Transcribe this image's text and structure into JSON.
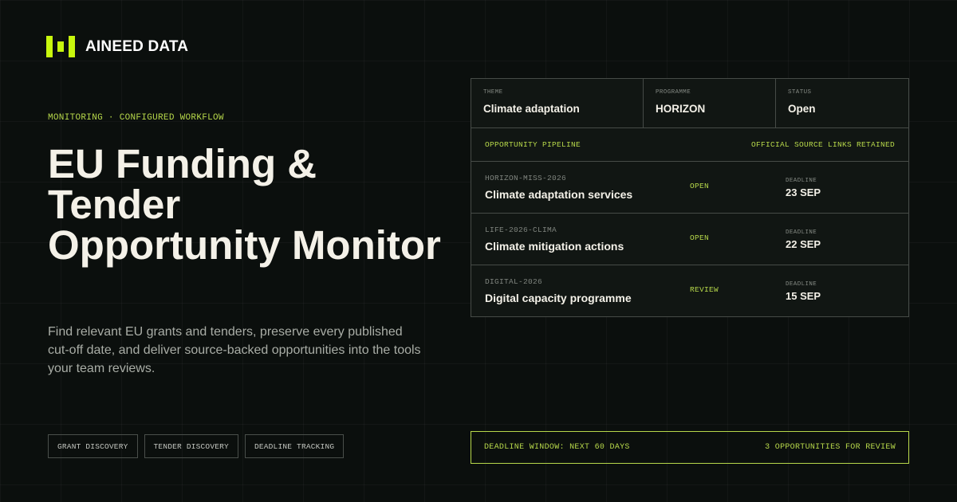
{
  "brand": {
    "name": "AINEED DATA",
    "logo_icon": "bars-logo-icon",
    "accent": "#c8f70d"
  },
  "hero": {
    "eyebrow": "MONITORING · CONFIGURED WORKFLOW",
    "headline_lines": [
      "EU Funding &",
      "Tender",
      "Opportunity Monitor"
    ],
    "description": "Find relevant EU grants and tenders, preserve every published cut-off date, and deliver source-backed opportunities into the tools your team reviews."
  },
  "tags": [
    "GRANT DISCOVERY",
    "TENDER DISCOVERY",
    "DEADLINE TRACKING"
  ],
  "panel": {
    "meta": [
      {
        "label": "THEME",
        "value": "Climate adaptation"
      },
      {
        "label": "PROGRAMME",
        "value": "HORIZON"
      },
      {
        "label": "STATUS",
        "value": "Open"
      }
    ],
    "pipeline": {
      "left": "OPPORTUNITY PIPELINE",
      "right": "OFFICIAL SOURCE LINKS RETAINED"
    },
    "opportunities": [
      {
        "code": "HORIZON-MISS-2026",
        "title": "Climate adaptation services",
        "status": "OPEN",
        "deadline_label": "DEADLINE",
        "deadline": "23 SEP"
      },
      {
        "code": "LIFE-2026-CLIMA",
        "title": "Climate mitigation actions",
        "status": "OPEN",
        "deadline_label": "DEADLINE",
        "deadline": "22 SEP"
      },
      {
        "code": "DIGITAL-2026",
        "title": "Digital capacity programme",
        "status": "REVIEW",
        "deadline_label": "DEADLINE",
        "deadline": "15 SEP"
      }
    ]
  },
  "window_bar": {
    "left": "DEADLINE WINDOW: NEXT 60 DAYS",
    "right": "3 OPPORTUNITIES FOR REVIEW"
  },
  "colors": {
    "background": "#0b0f0d",
    "accent_text": "#b7d84a",
    "panel": "#111613"
  }
}
